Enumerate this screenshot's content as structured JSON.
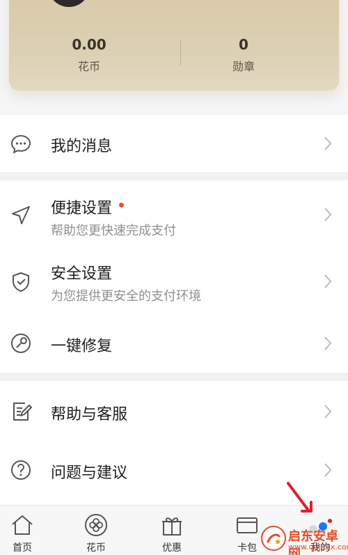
{
  "stats": {
    "flower_coin_value": "0.00",
    "flower_coin_label": "花币",
    "badge_value": "0",
    "badge_label": "勋章"
  },
  "menu": {
    "messages": {
      "title": "我的消息",
      "icon": "chat-bubble-icon"
    },
    "quick_settings": {
      "title": "便捷设置",
      "subtitle": "帮助您更快速完成支付",
      "icon": "send-arrow-icon",
      "has_badge_dot": true
    },
    "security_settings": {
      "title": "安全设置",
      "subtitle": "为您提供更安全的支付环境",
      "icon": "shield-check-icon"
    },
    "one_click_repair": {
      "title": "一键修复",
      "icon": "repair-icon"
    },
    "help_service": {
      "title": "帮助与客服",
      "icon": "edit-document-icon"
    },
    "feedback": {
      "title": "问题与建议",
      "icon": "question-icon"
    }
  },
  "tabbar": {
    "tabs": [
      {
        "label": "首页",
        "icon": "home-icon"
      },
      {
        "label": "花币",
        "icon": "flower-coin-icon"
      },
      {
        "label": "优惠",
        "icon": "gift-icon"
      },
      {
        "label": "卡包",
        "icon": "card-icon"
      },
      {
        "label": "我的",
        "icon": "profile-icon"
      }
    ]
  },
  "watermark": {
    "title": "启东安卓网",
    "url": "www.qdltdjx.com"
  },
  "colors": {
    "accent_dot": "#e4532f",
    "card_gold": "#dccfb1",
    "active_blue": "#1677ff",
    "arrow_red": "#e0202a"
  }
}
